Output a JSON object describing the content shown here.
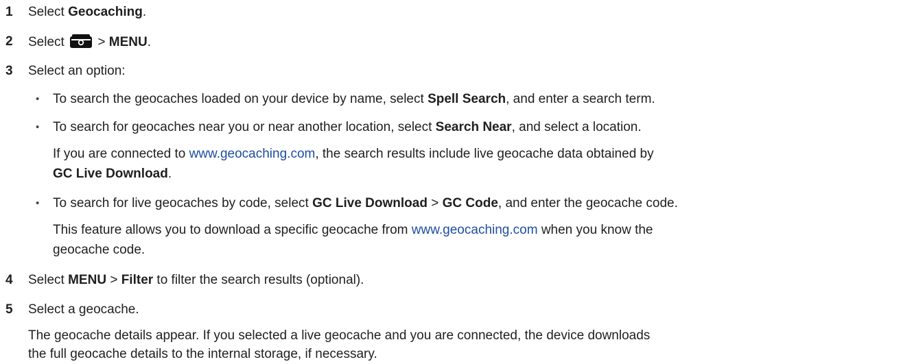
{
  "steps": [
    {
      "num": "1",
      "pre": "Select ",
      "bold": "Geocaching",
      "post": "."
    },
    {
      "num": "2",
      "pre": "Select ",
      "icon": "geocache-box-icon",
      "mid": " > ",
      "bold": "MENU",
      "post": "."
    },
    {
      "num": "3",
      "text": "Select an option:"
    },
    {
      "num": "4",
      "pre": "Select ",
      "bold1": "MENU",
      "mid": " > ",
      "bold2": "Filter",
      "post": " to filter the search results (optional)."
    },
    {
      "num": "5",
      "text": "Select a geocache."
    }
  ],
  "options": [
    {
      "pre": "To search the geocaches loaded on your device by name, select ",
      "bold": "Spell Search",
      "post": ", and enter a search term."
    },
    {
      "pre": "To search for geocaches near you or near another location, select ",
      "bold": "Search Near",
      "post": ", and select a location.",
      "note_pre": "If you are connected to ",
      "note_link": "www.geocaching.com",
      "note_post": ", the search results include live geocache data obtained by",
      "note_bold": "GC Live Download",
      "note_end": "."
    },
    {
      "pre": "To search for live geocaches by code, select ",
      "bold1": "GC Live Download",
      "mid": " > ",
      "bold2": "GC Code",
      "post": ", and enter the geocache code.",
      "note_pre": "This feature allows you to download a specific geocache from ",
      "note_link": "www.geocaching.com",
      "note_post": " when you know the",
      "note_line2": "geocache code."
    }
  ],
  "result": {
    "line1": "The geocache details appear. If you selected a live geocache and you are connected, the device downloads",
    "line2": "the full geocache details to the internal storage, if necessary."
  },
  "bullet_char": "•",
  "colors": {
    "text": "#1f1f1f",
    "link": "#1e4ea0"
  }
}
